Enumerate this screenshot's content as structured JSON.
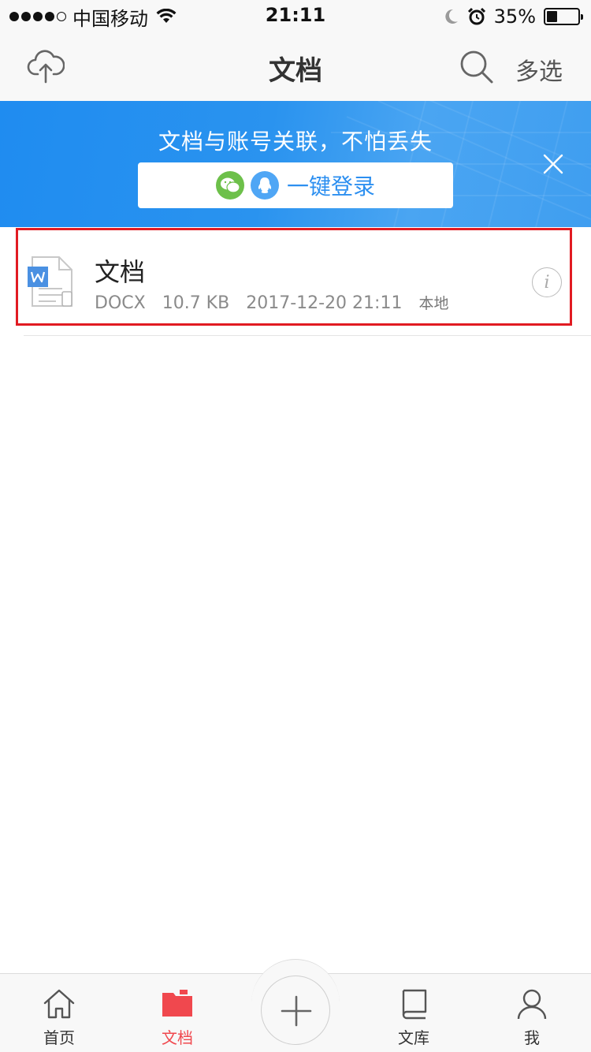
{
  "status_bar": {
    "carrier": "中国移动",
    "time": "21:11",
    "battery": "35%",
    "battery_level": 0.35
  },
  "nav": {
    "title": "文档",
    "multi_select": "多选",
    "left_icon": "cloud-upload-icon",
    "search_icon": "search-icon"
  },
  "banner": {
    "message": "文档与账号关联，不怕丢失",
    "login_label": "一键登录",
    "accent": "#2a93ef"
  },
  "file": {
    "name": "文档",
    "type": "DOCX",
    "size": "10.7 KB",
    "date": "2017-12-20 21:11",
    "location": "本地",
    "icon": "word-doc-icon",
    "highlight_color": "#e11b22"
  },
  "tabs": [
    {
      "label": "首页",
      "icon": "home-icon"
    },
    {
      "label": "文档",
      "icon": "folder-icon",
      "active": true
    },
    {
      "label": "文库",
      "icon": "book-icon"
    },
    {
      "label": "我",
      "icon": "user-icon"
    }
  ],
  "accent_active": "#f0484e"
}
